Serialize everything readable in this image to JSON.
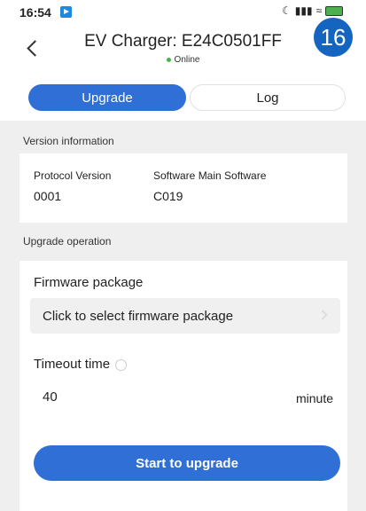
{
  "statusbar": {
    "time": "16:54",
    "icons": "☾ ∵ᴀᴜʟ ≈"
  },
  "header": {
    "title": "EV Charger: E24C0501FF",
    "status": "Online",
    "badge": "16"
  },
  "tabs": [
    {
      "label": "Upgrade",
      "active": true
    },
    {
      "label": "Log",
      "active": false
    }
  ],
  "version": {
    "section_label": "Version information",
    "items": [
      {
        "key": "Protocol Version",
        "value": "0001"
      },
      {
        "key": "Software Main Software",
        "value": "C019"
      }
    ]
  },
  "upgrade": {
    "section_label": "Upgrade operation",
    "firmware_label": "Firmware package",
    "firmware_placeholder": "Click to select firmware package",
    "timeout_label": "Timeout time",
    "timeout_value": "40",
    "timeout_unit": "minute",
    "start_label": "Start to upgrade"
  },
  "colors": {
    "accent": "#2f6fd6",
    "online": "#4caf50",
    "badge": "#1565c0"
  }
}
